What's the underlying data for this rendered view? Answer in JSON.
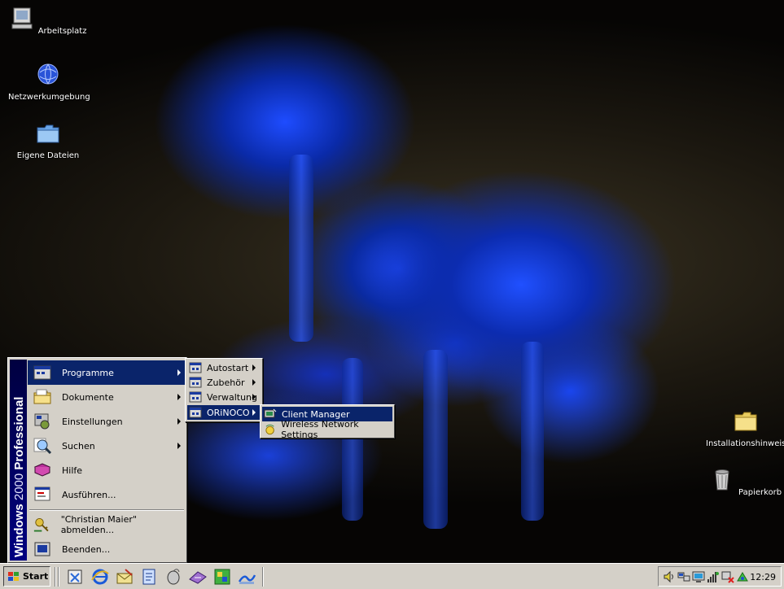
{
  "desktop": {
    "icons": [
      {
        "label": "Arbeitsplatz",
        "icon": "computer-icon"
      },
      {
        "label": "Netzwerkumgebung",
        "icon": "network-globe-icon"
      },
      {
        "label": "Eigene Dateien",
        "icon": "folder-icon"
      },
      {
        "label": "Installationshinweise",
        "icon": "folder-icon"
      },
      {
        "label": "Papierkorb",
        "icon": "recycle-bin-icon"
      }
    ]
  },
  "start_menu": {
    "banner_bold_1": "Windows",
    "banner_thin": " 2000 ",
    "banner_bold_2": "Professional",
    "items": [
      {
        "label": "Programme",
        "icon": "programs-icon",
        "submenu": true,
        "selected": true
      },
      {
        "label": "Dokumente",
        "icon": "documents-folder-icon",
        "submenu": true
      },
      {
        "label": "Einstellungen",
        "icon": "settings-icon",
        "submenu": true
      },
      {
        "label": "Suchen",
        "icon": "search-icon",
        "submenu": true
      },
      {
        "label": "Hilfe",
        "icon": "help-book-icon"
      },
      {
        "label": "Ausführen...",
        "icon": "run-icon"
      },
      {
        "label": "\"Christian Maier\" abmelden...",
        "icon": "logoff-key-icon"
      },
      {
        "label": "Beenden...",
        "icon": "shutdown-icon"
      }
    ]
  },
  "programs_menu": {
    "items": [
      {
        "label": "Autostart",
        "icon": "program-group-icon",
        "submenu": true
      },
      {
        "label": "Zubehör",
        "icon": "program-group-icon",
        "submenu": true
      },
      {
        "label": "Verwaltung",
        "icon": "program-group-icon",
        "submenu": true
      },
      {
        "label": "ORiNOCO",
        "icon": "program-group-icon",
        "submenu": true,
        "selected": true
      }
    ]
  },
  "orinoco_menu": {
    "items": [
      {
        "label": "Client Manager",
        "icon": "client-manager-icon",
        "selected": true
      },
      {
        "label": "Wireless Network Settings",
        "icon": "wireless-settings-icon"
      }
    ]
  },
  "taskbar": {
    "start_label": "Start",
    "quick_launch": [
      "office-icon",
      "internet-explorer-icon",
      "outlook-express-icon",
      "notepad-icon",
      "media-player-icon",
      "dial-icon",
      "app-icon",
      "tool-icon"
    ],
    "tray_icons": [
      "volume-icon",
      "network-icon",
      "monitor-icon",
      "signal-icon",
      "error-icon",
      "wireless-icon"
    ],
    "clock": "12:29"
  },
  "colors": {
    "selection": "#0a246a",
    "face": "#d4d0c8"
  }
}
